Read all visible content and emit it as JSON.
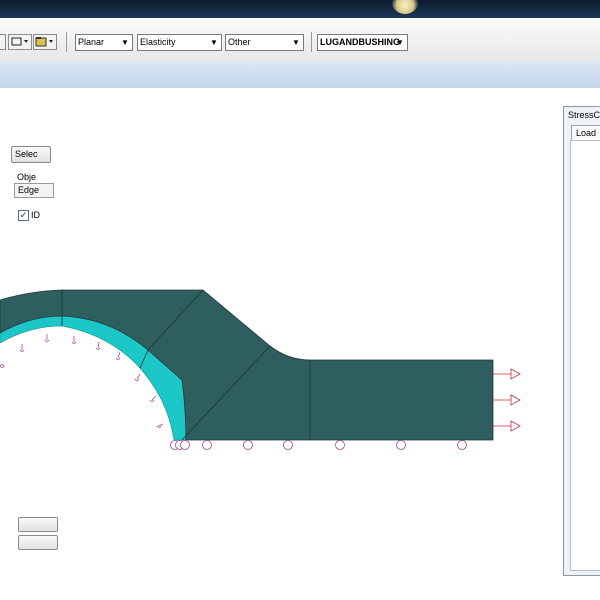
{
  "toolbar": {
    "combos": [
      {
        "value": "Planar"
      },
      {
        "value": "Elasticity"
      },
      {
        "value": "Other"
      },
      {
        "value": "LUGANDBUSHING"
      }
    ]
  },
  "dialog": {
    "title": "StressCh",
    "tab_label": "Load",
    "select_button_label": "Selec",
    "object_label": "Obje",
    "object_value": "Edge",
    "id_checkbox_label": "ID",
    "id_checked": "✓"
  },
  "colors": {
    "mesh_fill": "#2f5e5e",
    "bushing_fill": "#1cc7c7",
    "constraint": "#a54a8c",
    "load_arrow": "#c0303a"
  }
}
